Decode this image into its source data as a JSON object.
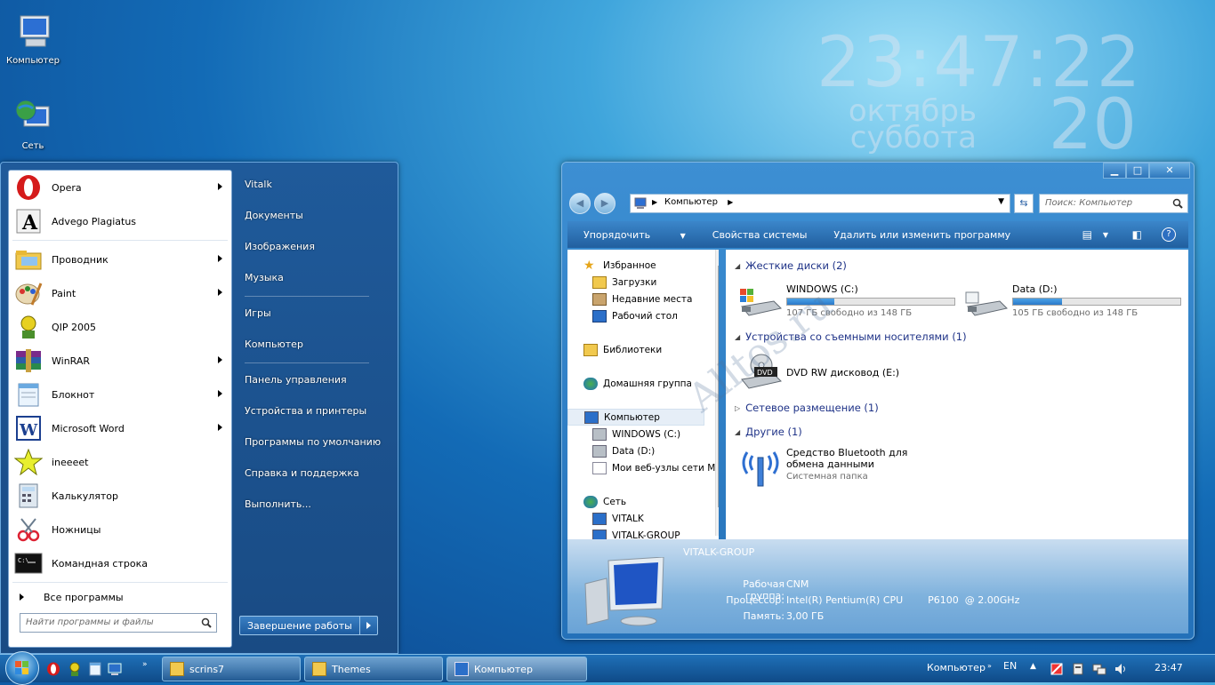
{
  "desktop": {
    "icons": [
      {
        "label": "Компьютер"
      },
      {
        "label": "Сеть"
      }
    ],
    "clock": {
      "time": "23:47:22",
      "month": "октябрь",
      "weekday": "суббота",
      "day": "20"
    }
  },
  "start_menu": {
    "programs": [
      {
        "label": "Opera",
        "arrow": true
      },
      {
        "label": "Advego Plagiatus",
        "arrow": false
      },
      {
        "label": "Проводник",
        "arrow": true
      },
      {
        "label": "Paint",
        "arrow": true
      },
      {
        "label": "QIP 2005",
        "arrow": false
      },
      {
        "label": "WinRAR",
        "arrow": true
      },
      {
        "label": "Блокнот",
        "arrow": true
      },
      {
        "label": "Microsoft Word",
        "arrow": true
      },
      {
        "label": "ineeeet",
        "arrow": false
      },
      {
        "label": "Калькулятор",
        "arrow": false
      },
      {
        "label": "Ножницы",
        "arrow": false
      },
      {
        "label": "Командная строка",
        "arrow": false
      }
    ],
    "all_programs": "Все программы",
    "search_placeholder": "Найти программы и файлы",
    "right": [
      "Vitalk",
      "Документы",
      "Изображения",
      "Музыка",
      "Игры",
      "Компьютер",
      "Панель управления",
      "Устройства и принтеры",
      "Программы по умолчанию",
      "Справка и поддержка",
      "Выполнить..."
    ],
    "shutdown": "Завершение работы"
  },
  "explorer": {
    "address": "Компьютер",
    "search_placeholder": "Поиск: Компьютер",
    "commands": [
      "Упорядочить",
      "Свойства системы",
      "Удалить или изменить программу"
    ],
    "nav": {
      "favorites": "Избранное",
      "fav_items": [
        "Загрузки",
        "Недавние места",
        "Рабочий стол"
      ],
      "libraries": "Библиотеки",
      "homegroup": "Домашняя группа",
      "computer": "Компьютер",
      "comp_items": [
        "WINDOWS (C:)",
        "Data (D:)",
        "Мои веб-узлы сети MSN"
      ],
      "network": "Сеть",
      "net_items": [
        "VITALK",
        "VITALK-GROUP"
      ]
    },
    "groups": {
      "hdd": "Жесткие диски (2)",
      "removable": "Устройства со съемными носителями (1)",
      "network": "Сетевое размещение (1)",
      "other": "Другие (1)"
    },
    "drives": [
      {
        "name": "WINDOWS (C:)",
        "free": "107 ГБ свободно из 148 ГБ",
        "used_fraction": 0.28
      },
      {
        "name": "Data (D:)",
        "free": "105 ГБ свободно из 148 ГБ",
        "used_fraction": 0.29
      }
    ],
    "dvd": "DVD RW дисковод (E:)",
    "dvd_badge": "DVD",
    "bluetooth": {
      "name": "Средство Bluetooth для обмена данными",
      "type": "Системная папка"
    },
    "details": {
      "name": "VITALK-GROUP",
      "wg_label": "Рабочая группа:",
      "wg": "CNM",
      "cpu_label": "Процессор:",
      "cpu": "Intel(R) Pentium(R) CPU        P6100  @ 2.00GHz",
      "mem_label": "Память:",
      "mem": "3,00 ГБ"
    },
    "watermark": "Alltos.ru"
  },
  "taskbar": {
    "tasks": [
      "scrins7",
      "Themes",
      "Компьютер"
    ],
    "toolbar_label": "Компьютер",
    "lang": "EN",
    "time": "23:47"
  }
}
